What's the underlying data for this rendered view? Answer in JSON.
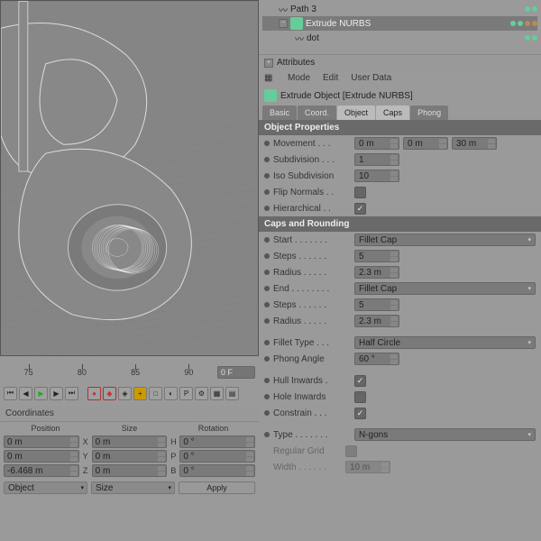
{
  "tree": {
    "items": [
      {
        "label": "Path 3",
        "icon": "path"
      },
      {
        "label": "Extrude NURBS",
        "icon": "extrude",
        "selected": true,
        "expanded": true
      },
      {
        "label": "dot",
        "icon": "path",
        "child": true
      }
    ]
  },
  "attributes": {
    "title": "Attributes"
  },
  "menu": {
    "mode": "Mode",
    "edit": "Edit",
    "userdata": "User Data"
  },
  "object": {
    "title": "Extrude Object [Extrude NURBS]"
  },
  "tabs": [
    "Basic",
    "Coord.",
    "Object",
    "Caps",
    "Phong"
  ],
  "section1": "Object Properties",
  "props1": {
    "movement": {
      "label": "Movement . . .",
      "v1": "0 m",
      "v2": "0 m",
      "v3": "30 m"
    },
    "subdivision": {
      "label": "Subdivision . . .",
      "v": "1"
    },
    "iso": {
      "label": "Iso Subdivision",
      "v": "10"
    },
    "flip": {
      "label": "Flip Normals . .",
      "checked": false
    },
    "hier": {
      "label": "Hierarchical . .",
      "checked": true
    }
  },
  "section2": "Caps and Rounding",
  "props2": {
    "start": {
      "label": "Start . . . . . . .",
      "v": "Fillet Cap"
    },
    "steps1": {
      "label": "Steps . . . . . .",
      "v": "5"
    },
    "radius1": {
      "label": "Radius . . . . .",
      "v": "2.3 m"
    },
    "end": {
      "label": "End . . . . . . . .",
      "v": "Fillet Cap"
    },
    "steps2": {
      "label": "Steps . . . . . .",
      "v": "5"
    },
    "radius2": {
      "label": "Radius . . . . .",
      "v": "2.3 m"
    },
    "fillet": {
      "label": "Fillet Type . . .",
      "v": "Half Circle"
    },
    "phong": {
      "label": "Phong Angle",
      "v": "60 °"
    },
    "hull": {
      "label": "Hull Inwards .",
      "checked": true
    },
    "hole": {
      "label": "Hole Inwards",
      "checked": false
    },
    "constrain": {
      "label": "Constrain . . .",
      "checked": true
    },
    "type": {
      "label": "Type . . . . . . .",
      "v": "N-gons"
    },
    "grid": {
      "label": "Regular Grid",
      "checked": false
    },
    "width": {
      "label": "Width . . . . . .",
      "v": "10 m"
    }
  },
  "timeline": {
    "ticks": [
      "75",
      "80",
      "85",
      "90"
    ],
    "frame": "0 F"
  },
  "coords": {
    "title": "Coordinates",
    "headers": [
      "Position",
      "Size",
      "Rotation"
    ],
    "rows": [
      {
        "p": "0 m",
        "a1": "X",
        "s": "0 m",
        "a2": "H",
        "r": "0 °"
      },
      {
        "p": "0 m",
        "a1": "Y",
        "s": "0 m",
        "a2": "P",
        "r": "0 °"
      },
      {
        "p": "-6.468 m",
        "a1": "Z",
        "s": "0 m",
        "a2": "B",
        "r": "0 °"
      }
    ],
    "btn1": "Object",
    "btn2": "Size",
    "apply": "Apply"
  }
}
